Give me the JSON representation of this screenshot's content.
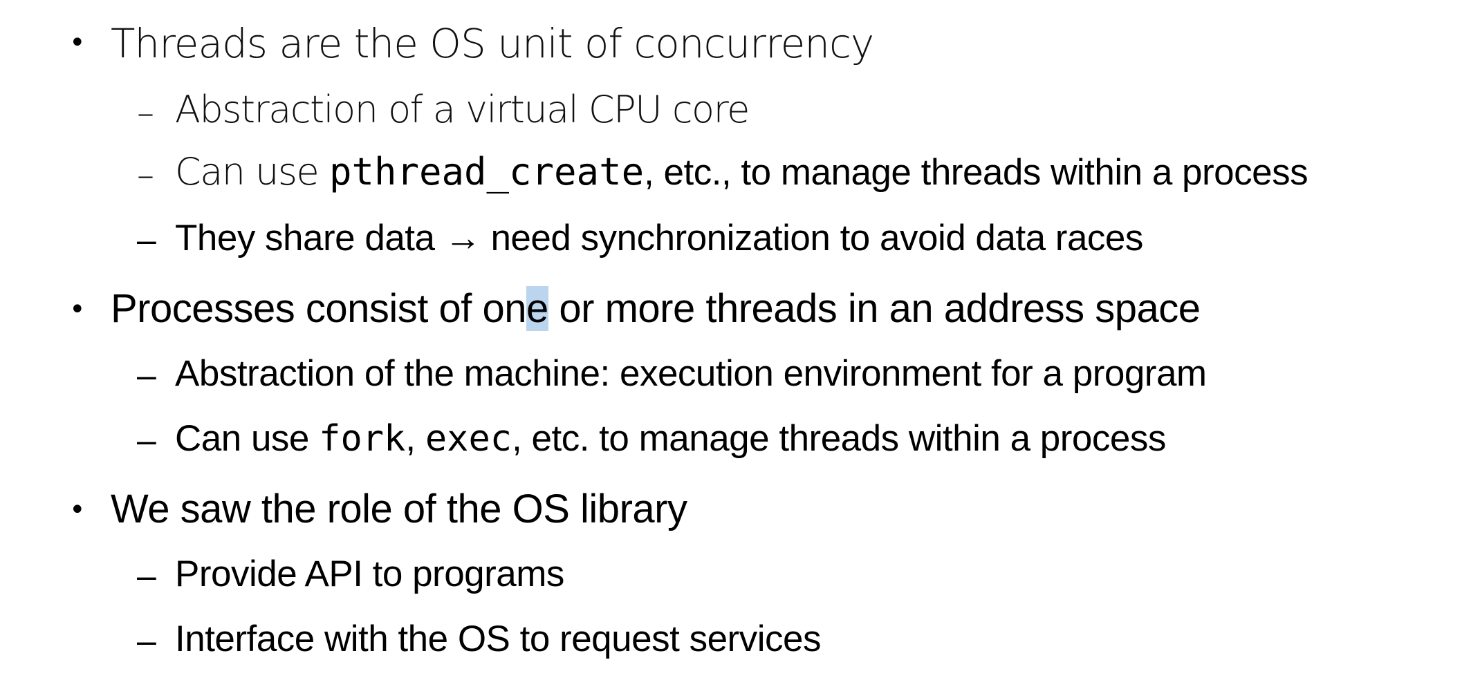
{
  "bullets": [
    {
      "text": "Threads are the OS unit of concurrency",
      "subs": [
        {
          "text": "Abstraction of a virtual CPU core"
        },
        {
          "pre": "Can use ",
          "code": "pthread_create",
          "post": ", etc., to manage threads within a process"
        },
        {
          "text": "They share data → need synchronization to avoid data races"
        }
      ]
    },
    {
      "text_a": "Processes consist of on",
      "text_sel": "e",
      "text_b": " or more threads in an address space",
      "subs": [
        {
          "text": "Abstraction of the machine: execution environment for a program"
        },
        {
          "pre": "Can use ",
          "code1": "fork",
          "mid": ", ",
          "code2": "exec",
          "post": ", etc. to manage threads within a process"
        }
      ]
    },
    {
      "text": "We saw the role of the OS library",
      "subs": [
        {
          "text": "Provide API to programs"
        },
        {
          "text": "Interface with the OS to request services"
        }
      ]
    }
  ],
  "symbols": {
    "bullet": "•",
    "dash_thin": "–",
    "dash": "–"
  }
}
